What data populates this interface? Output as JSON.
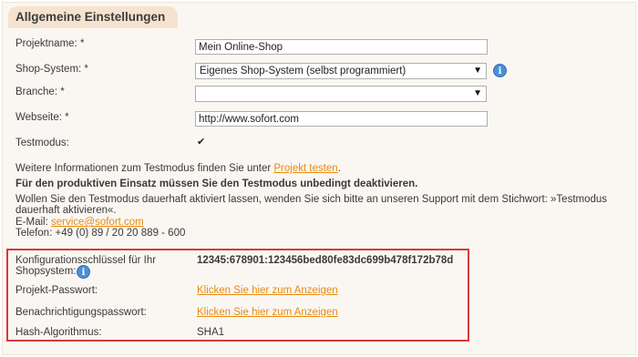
{
  "section": {
    "title": "Allgemeine Einstellungen"
  },
  "fields": {
    "project_name": {
      "label": "Projektname: *",
      "value": "Mein Online-Shop"
    },
    "shop_system": {
      "label": "Shop-System: *",
      "value": "Eigenes Shop-System (selbst programmiert)"
    },
    "branche": {
      "label": "Branche: *",
      "value": ""
    },
    "website": {
      "label": "Webseite: *",
      "value": "http://www.sofort.com"
    },
    "testmode": {
      "label": "Testmodus:",
      "checked": true
    }
  },
  "info": {
    "line1_text": "Weitere Informationen zum Testmodus finden Sie unter ",
    "line1_link": "Projekt testen",
    "line1_end": ".",
    "warning": "Für den produktiven Einsatz müssen Sie den Testmodus unbedingt deaktivieren.",
    "support_line1": "Wollen Sie den Testmodus dauerhaft aktiviert lassen, wenden Sie sich bitte an unseren Support mit dem Stichwort: »Testmodus",
    "support_line2": "dauerhaft aktivieren«.",
    "email_label": "E-Mail: ",
    "email": "service@sofort.com",
    "phone": "Telefon: +49 (0) 89 / 20 20 889 - 600"
  },
  "config": {
    "key_label_1": "Konfigurationsschlüssel für Ihr",
    "key_label_2": "Shopsystem:",
    "key_value": "12345:678901:123456bed80fe83dc699b478f172b78d",
    "password_label": "Projekt-Passwort:",
    "password_link": "Klicken Sie hier zum Anzeigen",
    "notify_label": "Benachrichtigungspasswort:",
    "notify_link": "Klicken Sie hier zum Anzeigen",
    "hash_label": "Hash-Algorithmus:",
    "hash_value": "SHA1"
  },
  "colors": {
    "accent": "#e88a12",
    "highlight_border": "#d9393a",
    "legend_bg": "#f5e3cf",
    "info_icon": "#4a8fd6"
  }
}
